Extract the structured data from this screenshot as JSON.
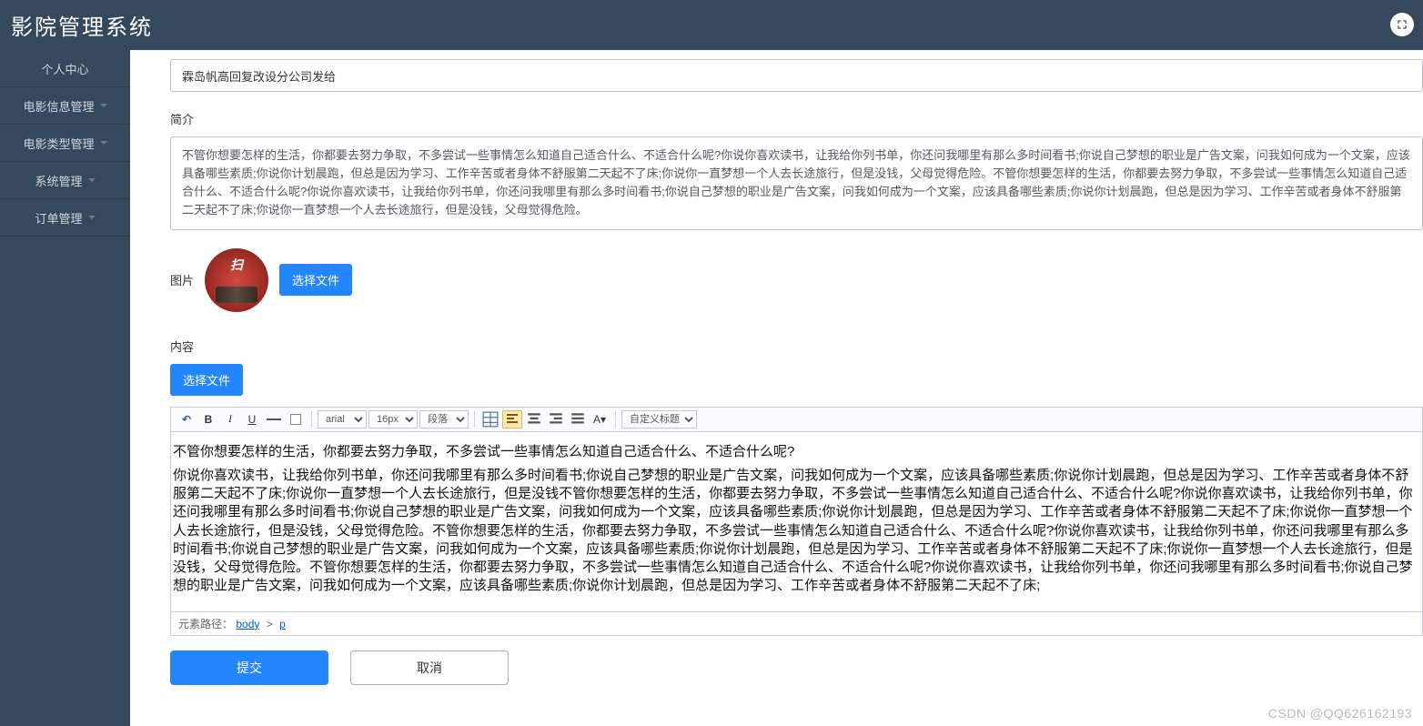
{
  "header": {
    "title": "影院管理系统"
  },
  "sidebar": {
    "items": [
      {
        "label": "个人中心"
      },
      {
        "label": "电影信息管理"
      },
      {
        "label": "电影类型管理"
      },
      {
        "label": "系统管理"
      },
      {
        "label": "订单管理"
      }
    ]
  },
  "form": {
    "title_value": "霖岛帆高回复改设分公司发给",
    "intro_label": "简介",
    "intro_value": "不管你想要怎样的生活，你都要去努力争取，不多尝试一些事情怎么知道自己适合什么、不适合什么呢?你说你喜欢读书，让我给你列书单，你还问我哪里有那么多时间看书;你说自己梦想的职业是广告文案，问我如何成为一个文案，应该具备哪些素质;你说你计划晨跑，但总是因为学习、工作辛苦或者身体不舒服第二天起不了床;你说你一直梦想一个人去长途旅行，但是没钱，父母觉得危险。不管你想要怎样的生活，你都要去努力争取，不多尝试一些事情怎么知道自己适合什么、不适合什么呢?你说你喜欢读书，让我给你列书单，你还问我哪里有那么多时间看书;你说自己梦想的职业是广告文案，问我如何成为一个文案，应该具备哪些素质;你说你计划晨跑，但总是因为学习、工作辛苦或者身体不舒服第二天起不了床;你说你一直梦想一个人去长途旅行，但是没钱，父母觉得危险。",
    "image_label": "图片",
    "choose_file_label": "选择文件",
    "content_label": "内容"
  },
  "editor": {
    "font_family": "arial",
    "font_size": "16px",
    "paragraph": "段落",
    "custom_title": "自定义标题",
    "body_line1": "不管你想要怎样的生活，你都要去努力争取，不多尝试一些事情怎么知道自己适合什么、不适合什么呢?",
    "body_line2": "你说你喜欢读书，让我给你列书单，你还问我哪里有那么多时间看书;你说自己梦想的职业是广告文案，问我如何成为一个文案，应该具备哪些素质;你说你计划晨跑，但总是因为学习、工作辛苦或者身体不舒服第二天起不了床;你说你一直梦想一个人去长途旅行，但是没钱不管你想要怎样的生活，你都要去努力争取，不多尝试一些事情怎么知道自己适合什么、不适合什么呢?你说你喜欢读书，让我给你列书单，你还问我哪里有那么多时间看书;你说自己梦想的职业是广告文案，问我如何成为一个文案，应该具备哪些素质;你说你计划晨跑，但总是因为学习、工作辛苦或者身体不舒服第二天起不了床;你说你一直梦想一个人去长途旅行，但是没钱，父母觉得危险。不管你想要怎样的生活，你都要去努力争取，不多尝试一些事情怎么知道自己适合什么、不适合什么呢?你说你喜欢读书，让我给你列书单，你还问我哪里有那么多时间看书;你说自己梦想的职业是广告文案，问我如何成为一个文案，应该具备哪些素质;你说你计划晨跑，但总是因为学习、工作辛苦或者身体不舒服第二天起不了床;你说你一直梦想一个人去长途旅行，但是没钱，父母觉得危险。不管你想要怎样的生活，你都要去努力争取，不多尝试一些事情怎么知道自己适合什么、不适合什么呢?你说你喜欢读书，让我给你列书单，你还问我哪里有那么多时间看书;你说自己梦想的职业是广告文案，问我如何成为一个文案，应该具备哪些素质;你说你计划晨跑，但总是因为学习、工作辛苦或者身体不舒服第二天起不了床;",
    "path_prefix": "元素路径：",
    "path_link1": "body",
    "path_link2": "p"
  },
  "actions": {
    "submit": "提交",
    "cancel": "取消"
  },
  "watermark": "CSDN @QQ626162193"
}
